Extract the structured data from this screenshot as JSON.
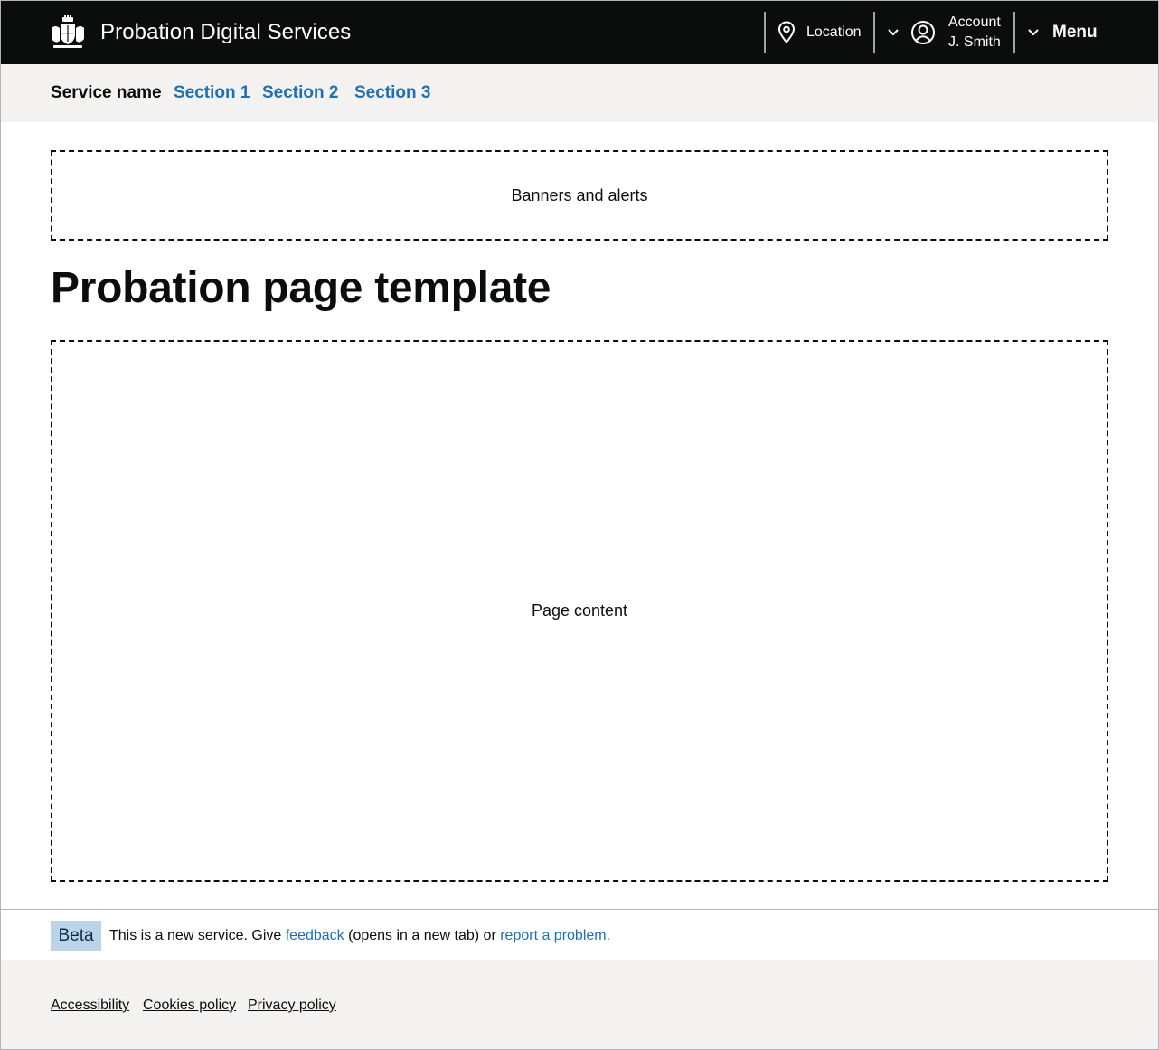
{
  "header": {
    "title": "Probation Digital Services",
    "crest_icon": "royal-crest-icon",
    "location_label": "Location",
    "account_label": "Account",
    "account_name": "J. Smith",
    "menu_label": "Menu"
  },
  "service_nav": {
    "service_name": "Service name",
    "links": [
      "Section 1",
      "Section 2",
      "Section 3"
    ],
    "link_color": "#1d70b8"
  },
  "main": {
    "banner_placeholder": "Banners and alerts",
    "page_title": "Probation page template",
    "content_placeholder": "Page content"
  },
  "phase_banner": {
    "tag": "Beta",
    "text_before": "This is a new service.  Give ",
    "feedback_link": "feedback",
    "text_middle": " (opens in a new tab) or ",
    "report_link": "report a problem.",
    "tag_color": "#bbd4ea"
  },
  "footer": {
    "links": [
      "Accessibility",
      "Cookies policy",
      "Privacy policy"
    ]
  },
  "colors": {
    "header_bg": "#0b0c0c",
    "nav_bg": "#f3f2f1",
    "text": "#0b0c0c"
  }
}
